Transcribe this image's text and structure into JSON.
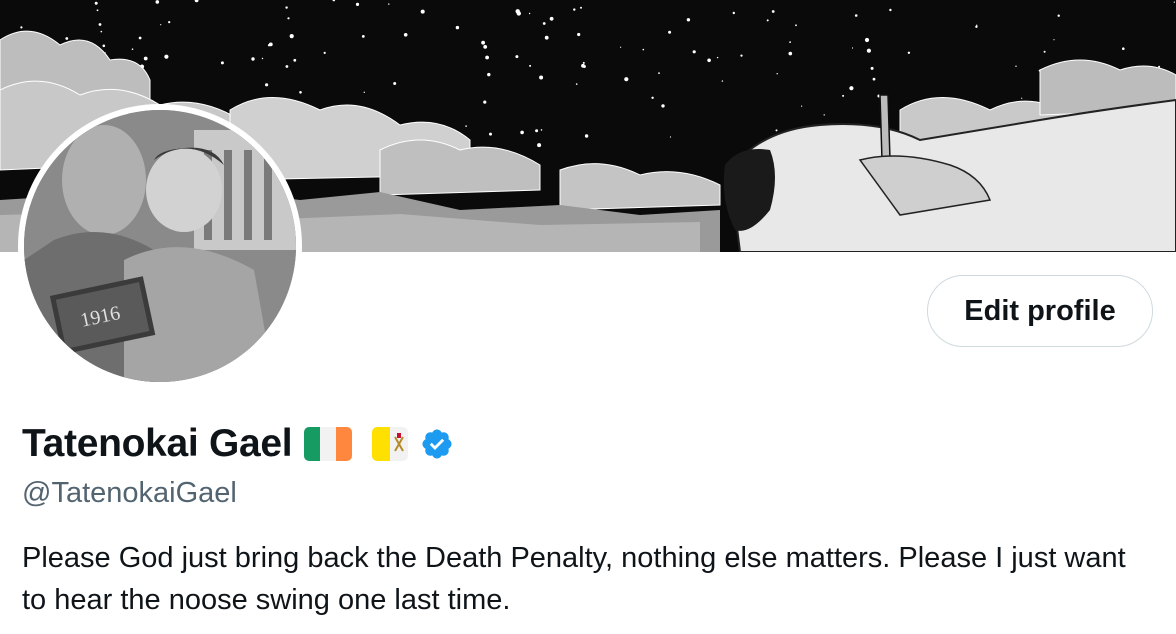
{
  "banner": {
    "icon": "manga-night-sky-banner"
  },
  "avatar": {
    "icon": "illustrated-avatar",
    "book_text": "1916"
  },
  "actions": {
    "edit_profile_label": "Edit profile"
  },
  "profile": {
    "display_name": "Tatenokai Gael",
    "flags": [
      "ireland-flag",
      "vatican-flag"
    ],
    "verified": true,
    "handle": "@TatenokaiGael",
    "bio": "Please God just bring back the Death Penalty, nothing else matters. Please I just want to hear the noose swing one last time."
  },
  "colors": {
    "verified_blue": "#1d9bf0",
    "handle_gray": "#536471",
    "button_border": "#cfd9de",
    "text": "#0f1419"
  }
}
